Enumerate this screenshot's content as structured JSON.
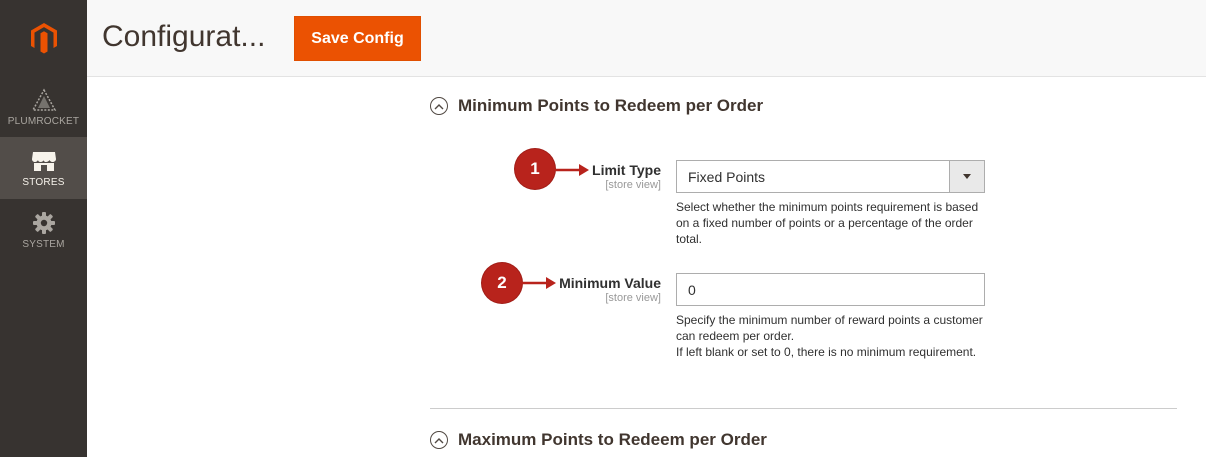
{
  "sidebar": {
    "logo": "magento-logo",
    "items": [
      {
        "label": "PLUMROCKET",
        "icon": "plumrocket-icon",
        "active": false
      },
      {
        "label": "STORES",
        "icon": "store-icon",
        "active": true
      },
      {
        "label": "SYSTEM",
        "icon": "gear-icon",
        "active": false
      }
    ]
  },
  "header": {
    "title": "Configurat...",
    "save_label": "Save Config"
  },
  "sections": {
    "minimum": {
      "title": "Minimum Points to Redeem per Order",
      "fields": {
        "limit_type": {
          "label": "Limit Type",
          "scope": "[store view]",
          "value": "Fixed Points",
          "note": "Select whether the minimum points requirement is based on a fixed number of points or a percentage of the order total."
        },
        "minimum_value": {
          "label": "Minimum Value",
          "scope": "[store view]",
          "value": "0",
          "note_lines": [
            "Specify the minimum number of reward points a customer can redeem per order.",
            "If left blank or set to 0, there is no minimum requirement."
          ]
        }
      }
    },
    "maximum": {
      "title": "Maximum Points to Redeem per Order"
    }
  },
  "annotations": [
    "1",
    "2"
  ],
  "colors": {
    "sidebar_bg": "#373330",
    "sidebar_active": "#524d49",
    "accent": "#eb5202",
    "badge": "#b8231c"
  }
}
